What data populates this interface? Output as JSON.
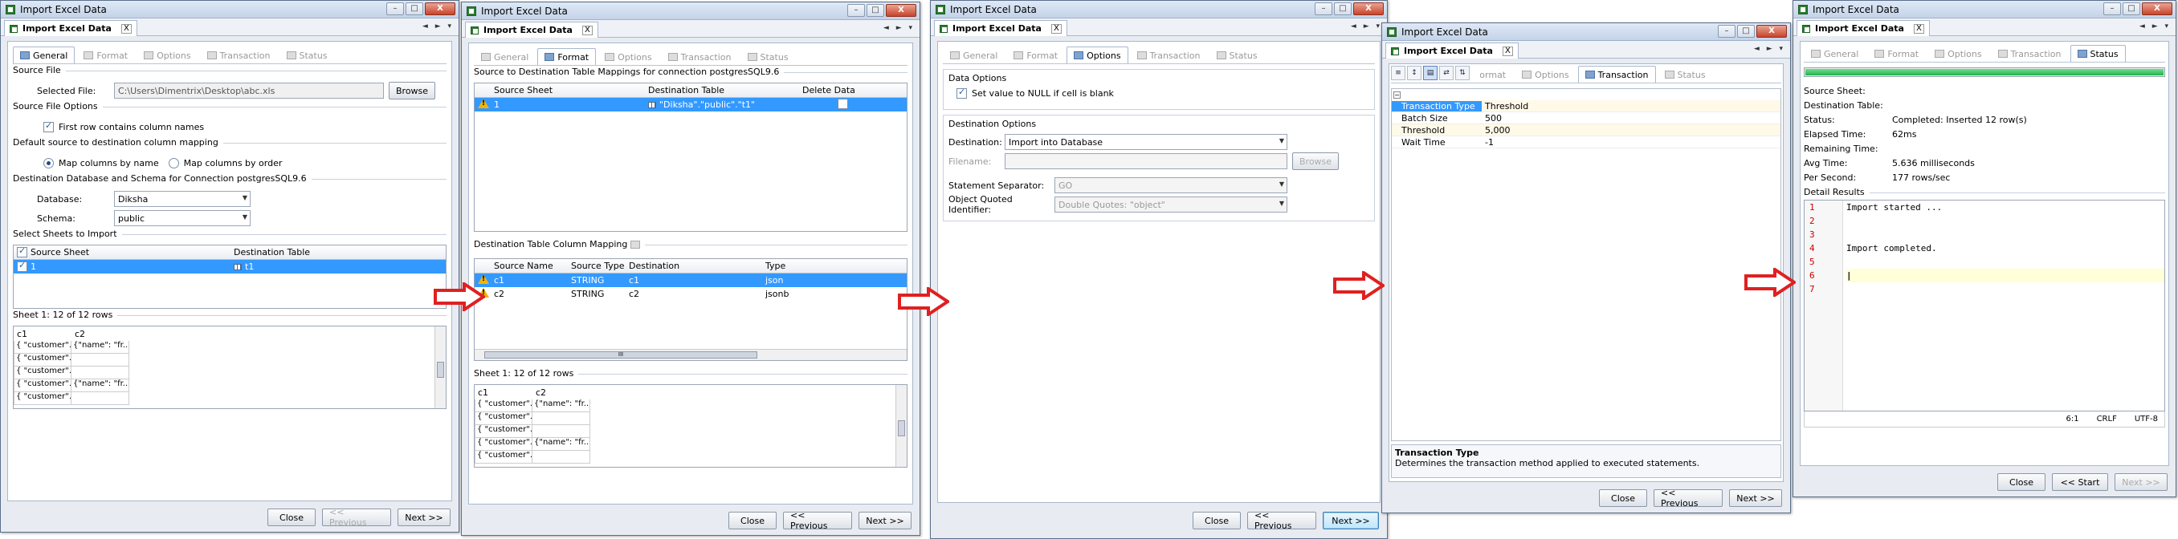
{
  "window_title": "Import Excel Data",
  "doc_tab": "Import Excel Data",
  "doc_tab_close": "X",
  "wbtn": {
    "min": "–",
    "max": "□",
    "close": "X"
  },
  "nav_arrows": "◄ ► ▾",
  "subtabs": [
    "General",
    "Format",
    "Options",
    "Transaction",
    "Status"
  ],
  "buttons": {
    "close": "Close",
    "previous": "<< Previous",
    "next": "Next >>",
    "start": "<< Start",
    "browse": "Browse"
  },
  "colors": {
    "selection": "#3399ff",
    "arrow": "#e02020",
    "progress": "#22b14c"
  },
  "general": {
    "source_file_label": "Source File",
    "selected_file_label": "Selected File:",
    "selected_file_value": "C:\\Users\\Dimentrix\\Desktop\\abc.xls",
    "options_label": "Source File Options",
    "first_row_label": "First row contains column names",
    "mapping_label": "Default source to destination column mapping",
    "map_name": "Map columns by name",
    "map_order": "Map columns by order",
    "dest_label": "Destination Database and Schema for Connection postgresSQL9.6",
    "database_label": "Database:",
    "database_value": "Diksha",
    "schema_label": "Schema:",
    "schema_value": "public",
    "sheets_label": "Select Sheets to Import",
    "sheets_headers": [
      "Source Sheet",
      "Destination Table"
    ],
    "sheet_row": {
      "source": "1",
      "dest": "t1"
    },
    "preview_label": "Sheet 1: 12 of 12 rows",
    "preview_headers": [
      "c1",
      "c2"
    ],
    "preview_rows": [
      [
        "{ \"customer\"...",
        "{\"name\": \"fr..."
      ],
      [
        "{ \"customer\"...",
        ""
      ],
      [
        "{ \"customer\"...",
        ""
      ],
      [
        "{ \"customer\"...",
        "{\"name\": \"fr..."
      ],
      [
        "{ \"customer\"...",
        ""
      ]
    ]
  },
  "format": {
    "map_label": "Source to Destination Table Mappings for connection postgresSQL9.6",
    "map_headers": [
      "Source Sheet",
      "Destination Table",
      "Delete Data"
    ],
    "map_row": {
      "source": "1",
      "dest": "\"Diksha\".\"public\".\"t1\""
    },
    "col_label": "Destination Table Column Mapping",
    "col_headers": [
      "Source Name",
      "Source Type",
      "Destination",
      "Type"
    ],
    "col_rows": [
      [
        "c1",
        "STRING",
        "c1",
        "json"
      ],
      [
        "c2",
        "STRING",
        "c2",
        "jsonb"
      ]
    ],
    "hscroll_mark": "III",
    "preview_label": "Sheet 1: 12 of 12 rows",
    "preview_headers": [
      "c1",
      "c2"
    ],
    "preview_rows": [
      [
        "{ \"customer\"...",
        "{\"name\": \"fr..."
      ],
      [
        "{ \"customer\"...",
        ""
      ],
      [
        "{ \"customer\"...",
        ""
      ],
      [
        "{ \"customer\"...",
        "{\"name\": \"fr..."
      ],
      [
        "{ \"customer\"...",
        ""
      ]
    ]
  },
  "options": {
    "data_label": "Data Options",
    "null_label": "Set value to NULL if cell is blank",
    "dest_label": "Destination Options",
    "destination_label": "Destination:",
    "destination_value": "Import into Database",
    "filename_label": "Filename:",
    "separator_label": "Statement Separator:",
    "separator_value": "GO",
    "quoted_label": "Object Quoted Identifier:",
    "quoted_value": "Double Quotes: \"object\""
  },
  "transaction": {
    "toolbar": [
      "≡",
      "↕",
      "▤",
      "⇄",
      "⇅"
    ],
    "group_mark": "−",
    "rows": [
      [
        "Transaction Type",
        "Threshold"
      ],
      [
        "Batch Size",
        "500"
      ],
      [
        "Threshold",
        "5,000"
      ],
      [
        "Wait Time",
        "-1"
      ]
    ],
    "desc_title": "Transaction Type",
    "desc_text": "Determines the transaction method applied to executed statements."
  },
  "status": {
    "progress": 1.0,
    "source_sheet_label": "Source Sheet:",
    "dest_table_label": "Destination Table:",
    "status_label": "Status:",
    "status_value": "Completed: Inserted 12 row(s)",
    "elapsed_label": "Elapsed Time:",
    "elapsed_value": "62ms",
    "remaining_label": "Remaining Time:",
    "avg_label": "Avg Time:",
    "avg_value": "5.636 milliseconds",
    "per_label": "Per Second:",
    "per_value": "177 rows/sec",
    "detail_label": "Detail Results",
    "lines": [
      {
        "n": "1",
        "t": "Import started ..."
      },
      {
        "n": "2",
        "t": ""
      },
      {
        "n": "3",
        "t": ""
      },
      {
        "n": "4",
        "t": "Import completed."
      },
      {
        "n": "5",
        "t": ""
      },
      {
        "n": "6",
        "t": ""
      },
      {
        "n": "7",
        "t": ""
      }
    ],
    "caret": "|",
    "footer": {
      "pos": "6:1",
      "eol": "CRLF",
      "enc": "UTF-8"
    }
  }
}
